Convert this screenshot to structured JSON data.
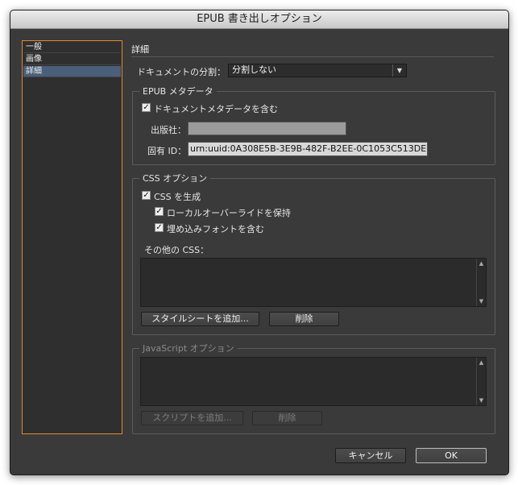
{
  "window": {
    "title": "EPUB 書き出しオプション"
  },
  "sidebar": {
    "items": [
      {
        "label": "一般",
        "selected": false
      },
      {
        "label": "画像",
        "selected": false
      },
      {
        "label": "詳細",
        "selected": true
      }
    ]
  },
  "main": {
    "section_title": "詳細",
    "split": {
      "label": "ドキュメントの分割：",
      "value": "分割しない"
    },
    "metadata": {
      "legend": "EPUB メタデータ",
      "include_label": "ドキュメントメタデータを含む",
      "include_checked": true,
      "publisher_label": "出版社：",
      "publisher_value": "",
      "id_label": "固有 ID：",
      "id_value": "urn:uuid:0A308E5B-3E9B-482F-B2EE-0C1053C513DE"
    },
    "css": {
      "legend": "CSS オプション",
      "generate_label": "CSS を生成",
      "local_override_label": "ローカルオーバーライドを保持",
      "embed_fonts_label": "埋め込みフォントを含む",
      "other_css_label": "その他の CSS：",
      "add_stylesheet_label": "スタイルシートを追加...",
      "delete_label": "削除"
    },
    "js": {
      "legend": "JavaScript オプション",
      "add_script_label": "スクリプトを追加...",
      "delete_label": "削除"
    }
  },
  "footer": {
    "cancel_label": "キャンセル",
    "ok_label": "OK"
  },
  "icons": {
    "check": "✓",
    "arrow_down": "▼",
    "arrow_up": "▲"
  },
  "colors": {
    "selection": "#4a5f7a",
    "focus_border": "#e08a2a",
    "dialog_bg": "#3a3a3a"
  }
}
